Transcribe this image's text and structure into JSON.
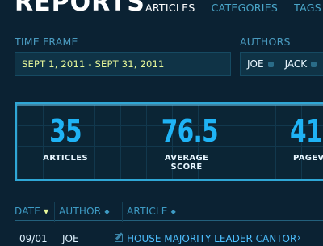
{
  "header": {
    "title": "REPORTS",
    "tabs": [
      {
        "label": "ARTICLES",
        "active": true
      },
      {
        "label": "CATEGORIES",
        "active": false
      },
      {
        "label": "TAGS",
        "active": false
      }
    ]
  },
  "filters": {
    "time_frame_label": "TIME FRAME",
    "time_frame_value": "SEPT 1, 2011 - SEPT 31, 2011",
    "authors_label": "AUTHORS",
    "authors": [
      "JOE",
      "JACK"
    ]
  },
  "stats": [
    {
      "value": "35",
      "caption": "ARTICLES"
    },
    {
      "value": "76.5",
      "caption": "AVERAGE SCORE"
    },
    {
      "value": "41",
      "caption": "PAGEVIEW"
    }
  ],
  "table": {
    "columns": [
      {
        "label": "DATE",
        "sort_active": true
      },
      {
        "label": "AUTHOR",
        "sort_active": false
      },
      {
        "label": "ARTICLE",
        "sort_active": false
      }
    ],
    "rows": [
      {
        "date": "09/01",
        "author": "JOE",
        "article": "HOUSE MAJORITY LEADER CANTOR"
      }
    ]
  },
  "colors": {
    "background": "#0b2233",
    "accent": "#1fb3f5",
    "highlight_text": "#e7f79a",
    "panel_border": "#2fa7d6"
  }
}
